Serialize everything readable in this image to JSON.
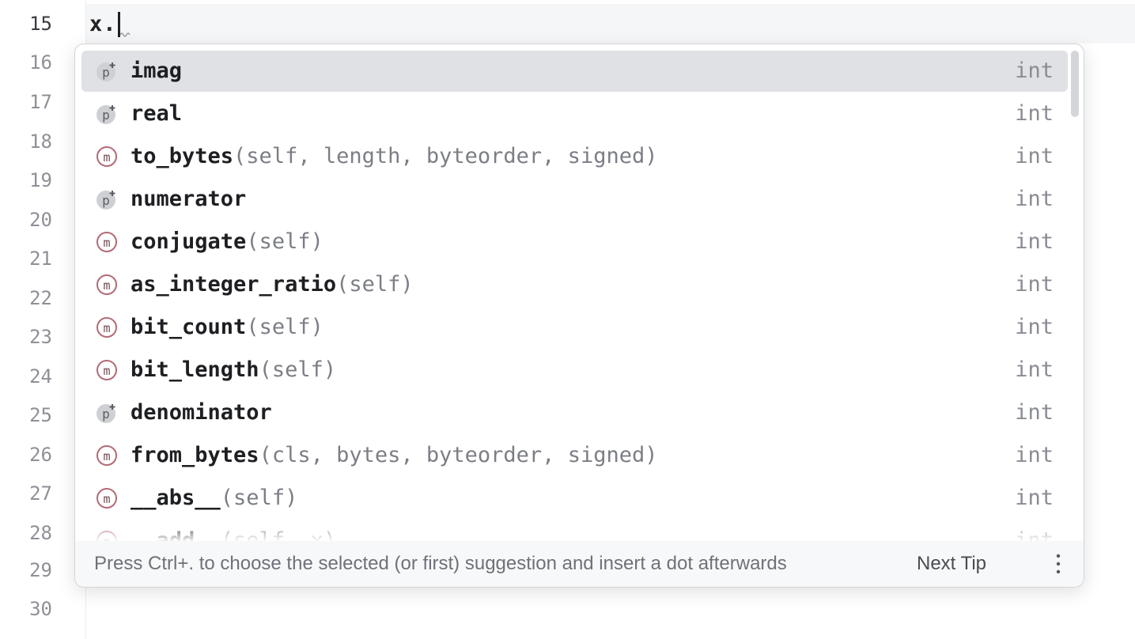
{
  "editor": {
    "line_numbers": [
      "15",
      "16",
      "17",
      "18",
      "19",
      "20",
      "21",
      "22",
      "23",
      "24",
      "25",
      "26",
      "27",
      "28",
      "29",
      "30"
    ],
    "current_line": "15",
    "code": "x."
  },
  "completion": {
    "items": [
      {
        "kind": "p",
        "name": "imag",
        "params": "",
        "type": "int",
        "selected": true
      },
      {
        "kind": "p",
        "name": "real",
        "params": "",
        "type": "int"
      },
      {
        "kind": "m",
        "name": "to_bytes",
        "params": "(self, length, byteorder, signed)",
        "type": "int"
      },
      {
        "kind": "p",
        "name": "numerator",
        "params": "",
        "type": "int"
      },
      {
        "kind": "m",
        "name": "conjugate",
        "params": "(self)",
        "type": "int"
      },
      {
        "kind": "m",
        "name": "as_integer_ratio",
        "params": "(self)",
        "type": "int"
      },
      {
        "kind": "m",
        "name": "bit_count",
        "params": "(self)",
        "type": "int"
      },
      {
        "kind": "m",
        "name": "bit_length",
        "params": "(self)",
        "type": "int"
      },
      {
        "kind": "p",
        "name": "denominator",
        "params": "",
        "type": "int"
      },
      {
        "kind": "m",
        "name": "from_bytes",
        "params": "(cls, bytes, byteorder, signed)",
        "type": "int"
      },
      {
        "kind": "m",
        "name": "__abs__",
        "params": "(self)",
        "type": "int"
      },
      {
        "kind": "m",
        "name": "__add__",
        "params": "(self, x)",
        "type": "int"
      }
    ],
    "footer": {
      "hint": "Press Ctrl+. to choose the selected (or first) suggestion and insert a dot afterwards",
      "next_tip": "Next Tip"
    },
    "icons": {
      "property": "property-icon",
      "method": "method-icon",
      "more": "more-vertical-icon"
    },
    "colors": {
      "selected_bg": "#dfe1e5",
      "param_text": "#7c7e86",
      "footer_bg": "#f7f8fa"
    }
  }
}
